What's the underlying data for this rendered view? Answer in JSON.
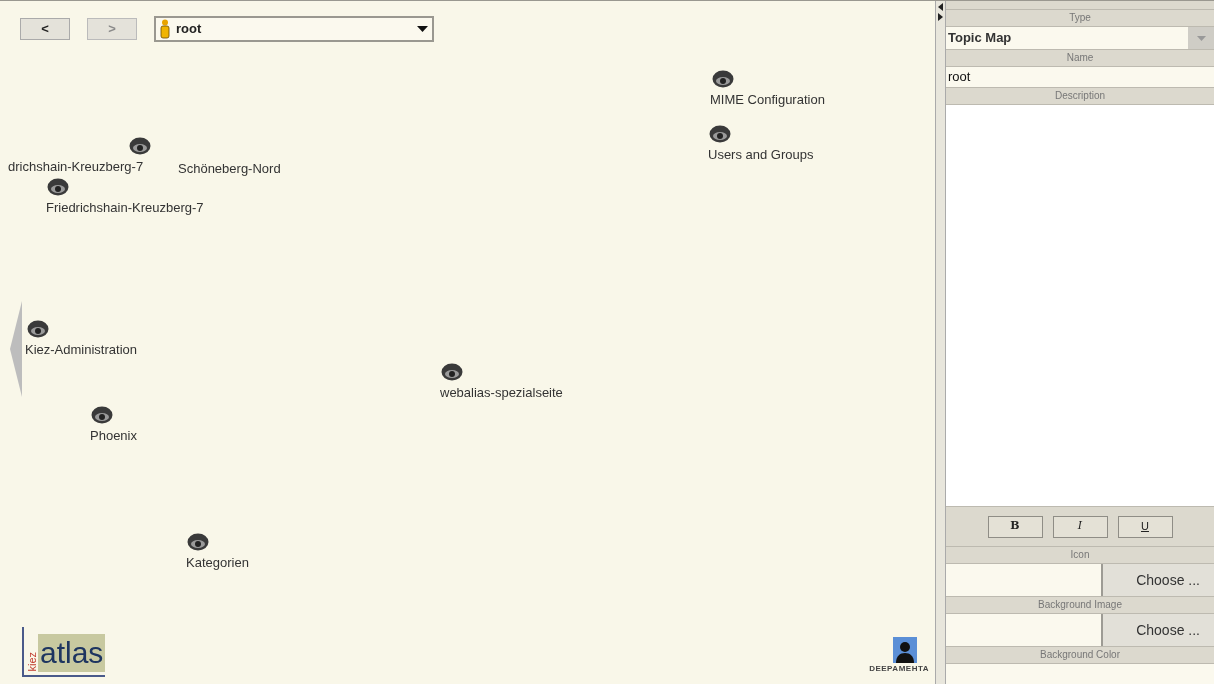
{
  "toolbar": {
    "back_button": {
      "label": "<",
      "disabled": false
    },
    "forward_button": {
      "label": ">",
      "disabled": true
    },
    "map_selector": {
      "value": "root"
    }
  },
  "nodes": [
    {
      "label": "MIME Configuration"
    },
    {
      "label": "Users and Groups"
    },
    {
      "label": "drichshain-Kreuzberg-7"
    },
    {
      "label": "Schöneberg-Nord"
    },
    {
      "label": "Friedrichshain-Kreuzberg-7"
    },
    {
      "label": "Kiez-Administration"
    },
    {
      "label": "webalias-spezialseite"
    },
    {
      "label": "Phoenix"
    },
    {
      "label": "Kategorien"
    }
  ],
  "logos": {
    "kiez_atlas": {
      "vertical": "kiez",
      "main": "atlas"
    },
    "deepamehta": "DEEPAMEHTA"
  },
  "properties": [
    {
      "label": "Type",
      "kind": "dropdown",
      "value": "Topic Map"
    },
    {
      "label": "Name",
      "kind": "text",
      "value": "root"
    },
    {
      "label": "Description",
      "kind": "textarea",
      "format_buttons": [
        {
          "label": "B",
          "kind": "bold"
        },
        {
          "label": "I",
          "kind": "italic"
        },
        {
          "label": "U",
          "kind": "underline"
        }
      ]
    },
    {
      "label": "Icon",
      "kind": "file",
      "button": "Choose ..."
    },
    {
      "label": "Background Image",
      "kind": "file",
      "button": "Choose ..."
    },
    {
      "label": "Background Color",
      "kind": "text"
    }
  ]
}
